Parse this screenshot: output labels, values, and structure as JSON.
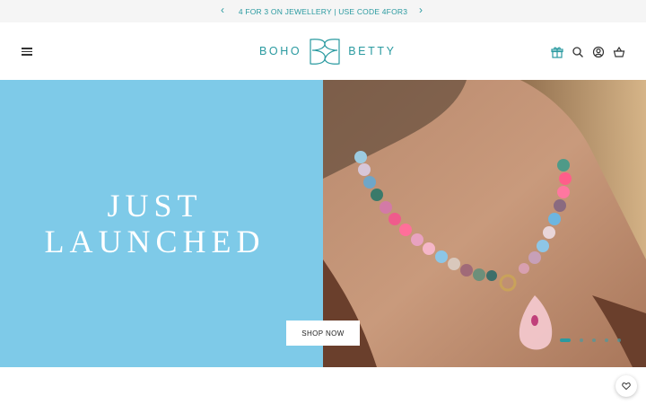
{
  "announcement": {
    "text": "4 FOR 3 ON JEWELLERY | USE CODE 4FOR3",
    "prev": "‹",
    "next": "›"
  },
  "header": {
    "logo_left": "BOHO",
    "logo_right": "BETTY",
    "icons": [
      "menu-icon",
      "gift-icon",
      "search-icon",
      "account-icon",
      "basket-icon"
    ]
  },
  "hero": {
    "title_line1": "JUST",
    "title_line2": "LAUNCHED",
    "cta": "SHOP NOW",
    "slides": 5,
    "active_slide": 1,
    "bg_color": "#7ecae8"
  },
  "colors": {
    "brand": "#2a9aa0",
    "announcement_bg": "#f5f5f5"
  },
  "floating": {
    "icon": "heart-icon"
  }
}
